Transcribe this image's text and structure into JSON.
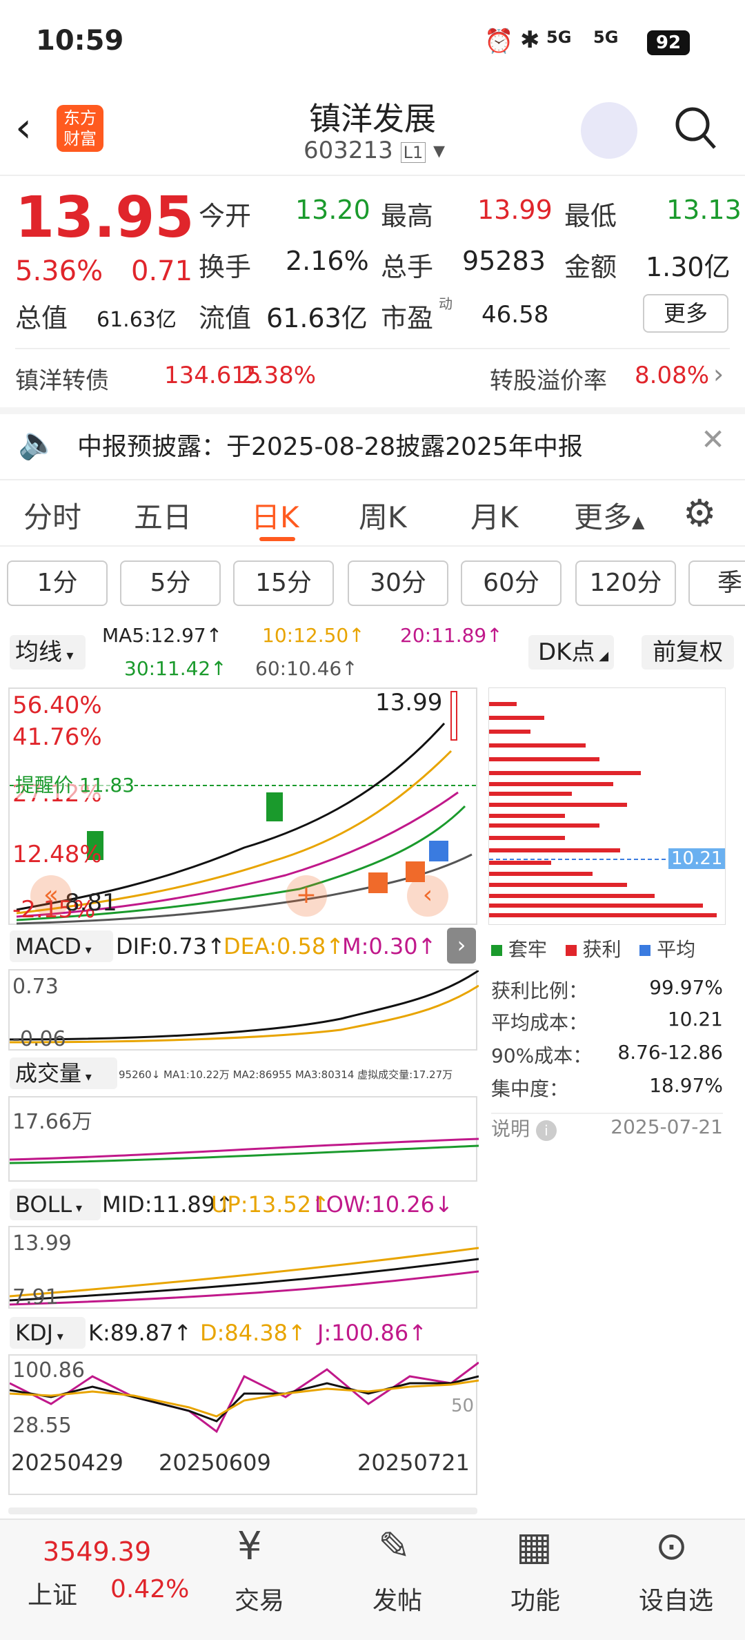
{
  "status": {
    "time": "10:59",
    "network1": "5G",
    "network2": "5G",
    "battery": "92"
  },
  "header": {
    "title": "镇洋发展",
    "code": "603213",
    "level": "L1",
    "logo_line1": "东方",
    "logo_line2": "财富"
  },
  "quote": {
    "price": "13.95",
    "change_pct": "5.36%",
    "change": "0.71",
    "open_label": "今开",
    "open": "13.20",
    "high_label": "最高",
    "high": "13.99",
    "low_label": "最低",
    "low": "13.13",
    "turnover_label": "换手",
    "turnover": "2.16%",
    "volume_label": "总手",
    "volume": "95283",
    "amount_label": "金额",
    "amount": "1.30亿",
    "mktcap_label": "总值",
    "mktcap": "61.63亿",
    "float_label": "流值",
    "float": "61.63亿",
    "pe_label": "市盈",
    "pe_sup": "动",
    "pe": "46.58",
    "more": "更多"
  },
  "bond": {
    "name": "镇洋转债",
    "price": "134.615",
    "pct": "2.38%",
    "premium_label": "转股溢价率",
    "premium": "8.08%"
  },
  "notice": {
    "text": "中报预披露：于2025-08-28披露2025年中报"
  },
  "tabs": [
    "分时",
    "五日",
    "日K",
    "周K",
    "月K",
    "更多"
  ],
  "periods": [
    "1分",
    "5分",
    "15分",
    "30分",
    "60分",
    "120分",
    "季"
  ],
  "ma": {
    "selector": "均线",
    "ma5": "MA5:12.97↑",
    "ma10": "10:12.50↑",
    "ma20": "20:11.89↑",
    "ma30": "30:11.42↑",
    "ma60": "60:10.46↑",
    "dk": "DK点",
    "adjust": "前复权"
  },
  "kchart": {
    "p1": "56.40%",
    "p2": "41.76%",
    "p3": "27.12%",
    "p4": "12.48%",
    "p5": "-2.15%",
    "high": "13.99",
    "remind": "提醒价 11.83",
    "low": "8.81",
    "avg_cost": "10.21"
  },
  "macd": {
    "name": "MACD",
    "dif": "DIF:0.73↑",
    "dea": "DEA:0.58↑",
    "m": "M:0.30↑",
    "top": "0.73",
    "bottom": "-0.06"
  },
  "vol": {
    "name": "成交量",
    "info": "95260↓ MA1:10.22万 MA2:86955 MA3:80314 虚拟成交量:17.27万",
    "top": "17.66万"
  },
  "boll": {
    "name": "BOLL",
    "mid": "MID:11.89↑",
    "up": "UP:13.52↑",
    "low": "LOW:10.26↓",
    "top": "13.99",
    "bottom": "7.91"
  },
  "kdj": {
    "name": "KDJ",
    "k": "K:89.87↑",
    "d": "D:84.38↑",
    "j": "J:100.86↑",
    "top": "100.86",
    "bottom": "28.55",
    "mark50": "50"
  },
  "dates": [
    "20250429",
    "20250609",
    "20250721"
  ],
  "chips": {
    "legend": [
      "套牢",
      "获利",
      "平均"
    ],
    "profit_label": "获利比例：",
    "profit": "99.97%",
    "avg_label": "平均成本：",
    "avg": "10.21",
    "c90_label": "90%成本：",
    "c90": "8.76-12.86",
    "conc_label": "集中度：",
    "conc": "18.97%",
    "note_label": "说明",
    "date": "2025-07-21"
  },
  "nav": {
    "index_value": "3549.39",
    "index_name": "上证",
    "index_pct": "0.42%",
    "trade": "交易",
    "post": "发帖",
    "func": "功能",
    "watch": "设自选"
  }
}
